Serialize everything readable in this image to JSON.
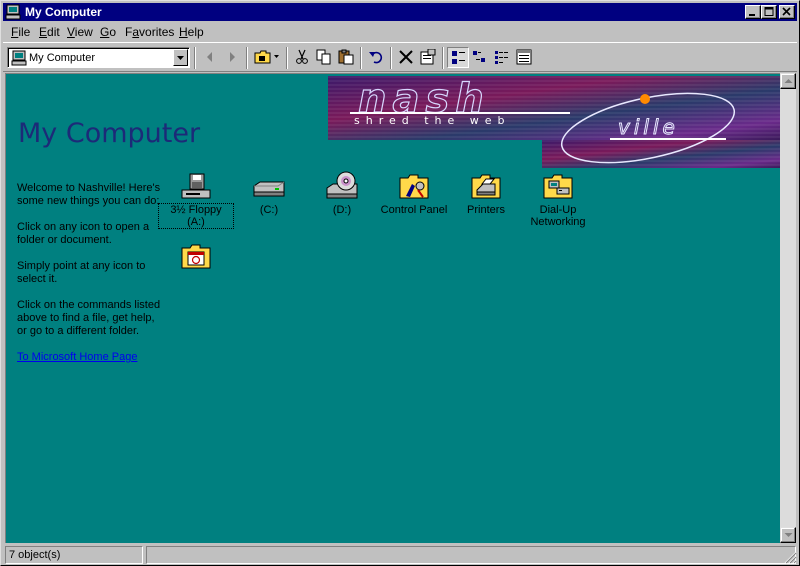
{
  "window": {
    "title": "My Computer"
  },
  "menu": {
    "items": [
      {
        "pre": "",
        "key": "F",
        "rest": "ile"
      },
      {
        "pre": "",
        "key": "E",
        "rest": "dit"
      },
      {
        "pre": "",
        "key": "V",
        "rest": "iew"
      },
      {
        "pre": "",
        "key": "G",
        "rest": "o"
      },
      {
        "pre": "F",
        "key": "a",
        "rest": "vorites"
      },
      {
        "pre": "",
        "key": "H",
        "rest": "elp"
      }
    ]
  },
  "address": {
    "value": "My Computer"
  },
  "banner": {
    "line1": "nash",
    "line2": "shred the web",
    "line3": "ville"
  },
  "page": {
    "title": "My Computer"
  },
  "info": {
    "p1": "Welcome to Nashville! Here's some new things you can do:",
    "p2": "Click on any icon to open a folder or document.",
    "p3": "Simply point at any icon to select it.",
    "p4": "Click on the commands listed above to find a file, get help, or go to a different folder.",
    "link": "To Microsoft Home Page"
  },
  "icons": [
    {
      "label": "3½ Floppy (A:)",
      "icon": "floppy-drive-icon",
      "selected": true
    },
    {
      "label": "(C:)",
      "icon": "hard-drive-icon"
    },
    {
      "label": "(D:)",
      "icon": "cd-drive-icon"
    },
    {
      "label": "Control Panel",
      "icon": "control-panel-icon"
    },
    {
      "label": "Printers",
      "icon": "printers-folder-icon"
    },
    {
      "label": "Dial-Up Networking",
      "icon": "dialup-networking-icon"
    },
    {
      "label": "",
      "icon": "scheduled-tasks-folder-icon"
    }
  ],
  "status": {
    "text": "7 object(s)"
  },
  "colors": {
    "titlebar": "#000080",
    "content_bg": "#008080",
    "title_text": "#1c2a78",
    "link": "#0000ee"
  }
}
